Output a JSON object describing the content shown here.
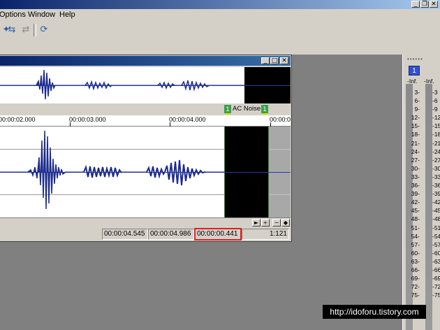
{
  "menu": {
    "options": "Options",
    "window": "Window",
    "help": "Help"
  },
  "system_buttons": {
    "minimize": "_",
    "restore": "❐",
    "close": "✕"
  },
  "data_window": {
    "buttons": {
      "minimize": "_",
      "maximize": "□",
      "close": "✕"
    },
    "marker": {
      "number_left": "1",
      "label": "AC Noise",
      "number_right": "1"
    },
    "ruler_labels": [
      "00:00:02.000",
      "00:00:03.000",
      "00:00:04.000",
      "00:00:0"
    ],
    "status": {
      "selection_start": "00:00:04.545",
      "selection_end": "00:00:04.986",
      "selection_length": "00:00:00.441",
      "zoom_ratio": "1:121"
    }
  },
  "meter": {
    "channel": "1",
    "inf_left": "-Inf.",
    "inf_right": "-Inf.",
    "scale": [
      "3",
      "6",
      "9",
      "12",
      "15",
      "18",
      "21",
      "24",
      "27",
      "30",
      "33",
      "36",
      "39",
      "42",
      "45",
      "48",
      "51",
      "54",
      "57",
      "60",
      "63",
      "66",
      "69",
      "72",
      "75"
    ]
  },
  "watermark": "http://idoforu.tistory.com",
  "colors": {
    "waveform": "#1c2c8c",
    "highlight_box": "#e02020",
    "marker_flag": "#3aa04a",
    "title_gradient_start": "#0a246a"
  }
}
